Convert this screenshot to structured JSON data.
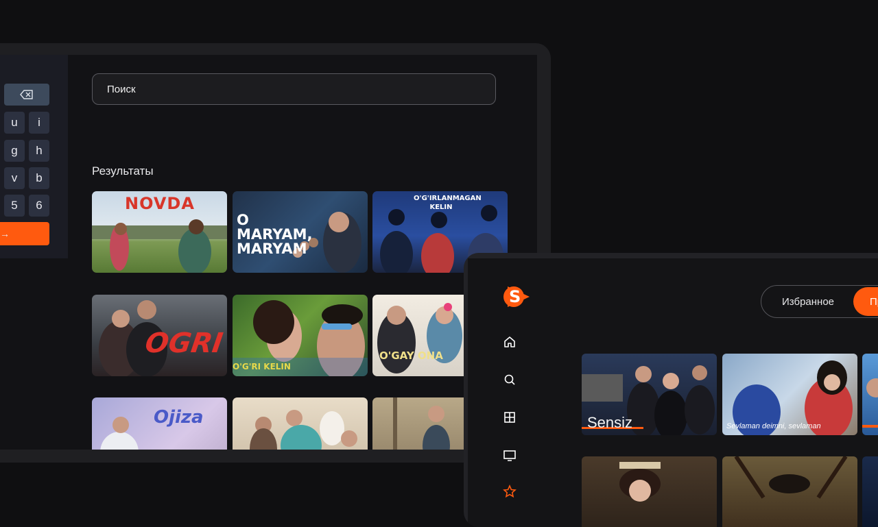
{
  "search_screen": {
    "keyboard": {
      "backspace_symbol": "⌫",
      "rows": [
        [
          "u",
          "i"
        ],
        [
          "g",
          "h"
        ],
        [
          "v",
          "b"
        ],
        [
          "5",
          "6"
        ]
      ],
      "enter_symbol": "→"
    },
    "search": {
      "placeholder": "Поиск"
    },
    "results_label": "Результаты",
    "results": [
      {
        "title": "NOVDA"
      },
      {
        "title": "O MARYAM, MARYAM"
      },
      {
        "title": "O'G'IRLANMAGAN KELIN"
      },
      {
        "title": "OGRI"
      },
      {
        "title": "O'G'RI KELIN"
      },
      {
        "title": "O'GAY ONA"
      },
      {
        "title": "Ojiza"
      },
      {
        "title": ""
      },
      {
        "title": ""
      }
    ]
  },
  "home_screen": {
    "brand_letter": "S",
    "nav": [
      "home-icon",
      "search-icon",
      "grid-icon",
      "tv-icon",
      "star-icon"
    ],
    "tabs": {
      "favorites": "Избранное",
      "active": "Пр"
    },
    "row1": [
      {
        "title": "Sensiz"
      },
      {
        "title": "Sevlaman deimni, sevlaman"
      },
      {
        "title": ""
      }
    ]
  },
  "colors": {
    "accent": "#ff5a0f",
    "bg": "#0f0f11"
  }
}
